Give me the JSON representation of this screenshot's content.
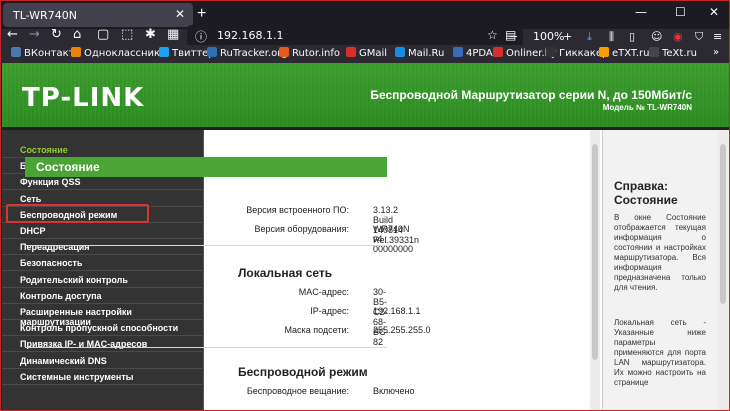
{
  "browser": {
    "tab_title": "TL-WR740N",
    "tab_close": "✕",
    "new_tab": "+",
    "url": "192.168.1.1",
    "zoom": "100%",
    "win_min": "—",
    "win_max": "☐",
    "win_close": "✕"
  },
  "bookmarks": [
    {
      "label": "ВКонтакте",
      "color": "#4a76a8"
    },
    {
      "label": "Одноклассники",
      "color": "#ee8208"
    },
    {
      "label": "Твиттер",
      "color": "#1da1f2"
    },
    {
      "label": "RuTracker.org",
      "color": "#2b6fb6"
    },
    {
      "label": "Rutor.info",
      "color": "#e05a1e"
    },
    {
      "label": "GMail",
      "color": "#d93025"
    },
    {
      "label": "Mail.Ru",
      "color": "#168de2"
    },
    {
      "label": "4PDA",
      "color": "#3a6ab8"
    },
    {
      "label": "Onliner.by",
      "color": "#d32f2f"
    },
    {
      "label": "Гиккакер",
      "color": "#333333"
    },
    {
      "label": "eTXT.ru",
      "color": "#f4a000"
    },
    {
      "label": "TeXt.ru",
      "color": "#444444"
    }
  ],
  "banner": {
    "logo": "TP-LINK",
    "title": "Беспроводной Маршрутизатор серии N, до 150Мбит/с",
    "model": "Модель № TL-WR740N"
  },
  "sidebar": [
    "Состояние",
    "Быстрая настройка",
    "Функция QSS",
    "Сеть",
    "Беспроводной режим",
    "DHCP",
    "Переадресация",
    "Безопасность",
    "Родительский контроль",
    "Контроль доступа",
    "Расширенные настройки маршрутизации",
    "Контроль пропускной способности",
    "Привязка IP- и MAC-адресов",
    "Динамический DNS",
    "Системные инструменты"
  ],
  "main": {
    "section": "Состояние",
    "firmware_label": "Версия встроенного ПО:",
    "firmware_value": "3.13.2 Build 140814 Rel.39331n",
    "hardware_label": "Версия оборудования:",
    "hardware_value": "WR740N v4 00000000",
    "lan_title": "Локальная сеть",
    "mac_label": "MAC-адрес:",
    "mac_value": "30-B5-C2-68-BC-82",
    "ip_label": "IP-адрес:",
    "ip_value": "192.168.1.1",
    "mask_label": "Маска подсети:",
    "mask_value": "255.255.255.0",
    "wireless_title": "Беспроводной режим",
    "broadcast_label": "Беспроводное вещание:",
    "broadcast_value": "Включено"
  },
  "help": {
    "title": "Справка: Состояние",
    "p1": "В окне Состояние отображается текущая информация о состоянии и настройках маршрутизатора. Вся информация предназначена только для чтения.",
    "p2": "Локальная сеть - Указанные ниже параметры применяются для порта LAN маршрутизатора. Их можно настроить на странице"
  }
}
